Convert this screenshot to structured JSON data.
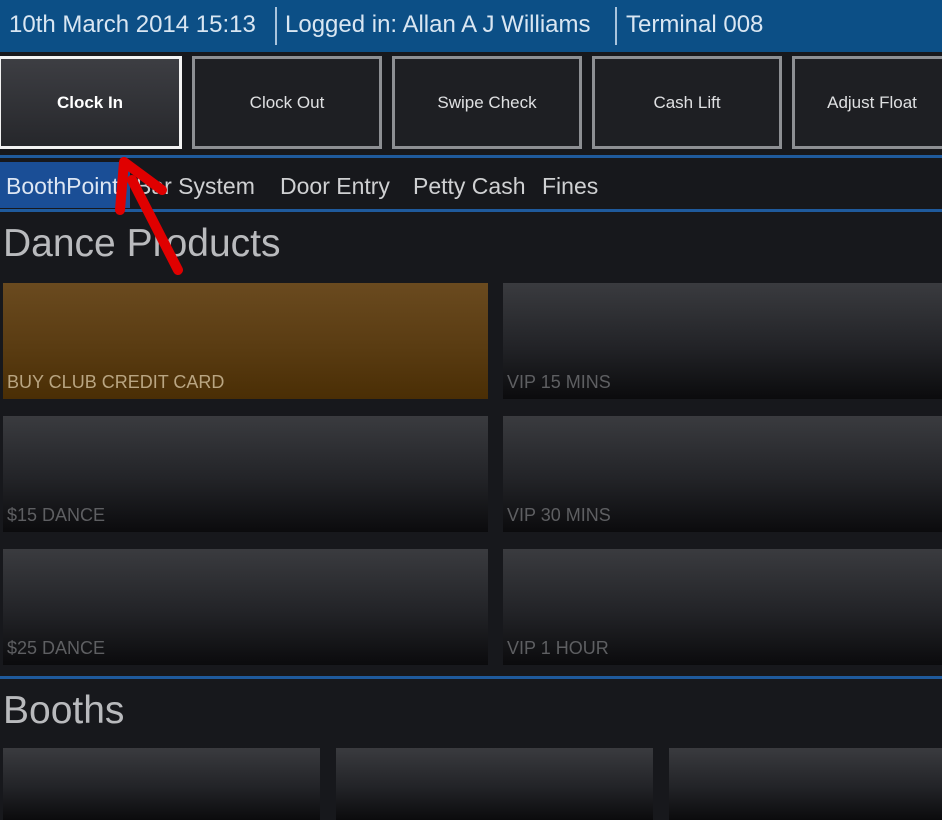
{
  "statusbar": {
    "datetime": "10th March 2014 15:13",
    "login": "Logged in: Allan A J Williams",
    "terminal": "Terminal 008"
  },
  "actions": {
    "clock_in": "Clock In",
    "clock_out": "Clock Out",
    "swipe_check": "Swipe Check",
    "cash_lift": "Cash Lift",
    "adjust_float": "Adjust Float"
  },
  "tabs": {
    "boothpoint": "BoothPoint",
    "bar_system": "Bar System",
    "door_entry": "Door Entry",
    "petty_cash": "Petty Cash",
    "fines": "Fines"
  },
  "dance_products": {
    "title": "Dance Products",
    "items": [
      "BUY CLUB CREDIT CARD",
      "VIP 15 MINS",
      "$15 DANCE",
      "VIP 30 MINS",
      "$25 DANCE",
      "VIP 1 HOUR"
    ]
  },
  "booths": {
    "title": "Booths"
  },
  "colors": {
    "header_bg": "#0c4f86",
    "accent_blue": "#1a4e96",
    "gold_tile": "#5a3c12",
    "annotation_arrow": "#e00000"
  }
}
